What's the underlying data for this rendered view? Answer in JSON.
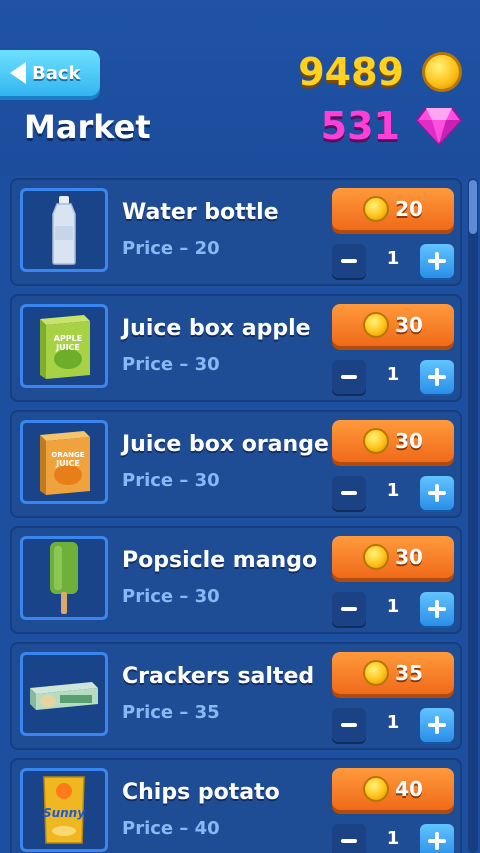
{
  "header": {
    "back_label": "Back",
    "title": "Market",
    "coins": "9489",
    "gems": "531"
  },
  "items": [
    {
      "name": "Water bottle",
      "price_text": "Price – 20",
      "buy_value": "20",
      "quantity": "1",
      "icon": "water-bottle-icon"
    },
    {
      "name": "Juice box apple",
      "price_text": "Price – 30",
      "buy_value": "30",
      "quantity": "1",
      "icon": "juice-box-apple-icon"
    },
    {
      "name": "Juice box orange",
      "price_text": "Price – 30",
      "buy_value": "30",
      "quantity": "1",
      "icon": "juice-box-orange-icon"
    },
    {
      "name": "Popsicle mango",
      "price_text": "Price – 30",
      "buy_value": "30",
      "quantity": "1",
      "icon": "popsicle-icon"
    },
    {
      "name": "Crackers salted",
      "price_text": "Price – 35",
      "buy_value": "35",
      "quantity": "1",
      "icon": "crackers-icon"
    },
    {
      "name": "Chips potato",
      "price_text": "Price – 40",
      "buy_value": "40",
      "quantity": "1",
      "icon": "chips-bag-icon"
    }
  ],
  "icon_labels": {
    "juice_apple": [
      "APPLE",
      "JUICE"
    ],
    "juice_orange": [
      "ORANGE",
      "JUICE"
    ],
    "chips_brand": "Sunny"
  },
  "colors": {
    "background": "#1d4fa0",
    "coin_gold": "#ffd21f",
    "gem_pink": "#ff3fd8",
    "buy_orange": "#f0801f",
    "plus_blue": "#2a8ee8"
  }
}
